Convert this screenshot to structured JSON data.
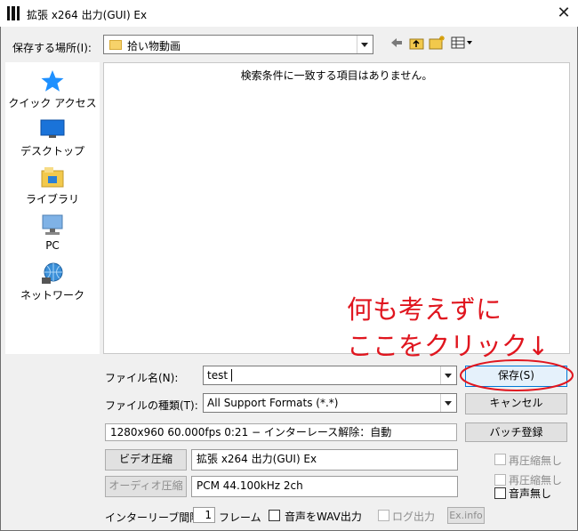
{
  "window": {
    "title": "拡張 x264 出力(GUI) Ex",
    "close_glyph": "✕"
  },
  "location": {
    "label": "保存する場所(I):",
    "current_folder": "拾い物動画"
  },
  "sidebar": {
    "items": [
      {
        "label": "クイック アクセス",
        "icon": "star-icon"
      },
      {
        "label": "デスクトップ",
        "icon": "desktop-icon"
      },
      {
        "label": "ライブラリ",
        "icon": "library-icon"
      },
      {
        "label": "PC",
        "icon": "pc-icon"
      },
      {
        "label": "ネットワーク",
        "icon": "network-icon"
      }
    ]
  },
  "file_list": {
    "empty_message": "検索条件に一致する項目はありません。"
  },
  "annotation": {
    "line1": "何も考えずに",
    "line2": "ここをクリック↓",
    "color": "#e0161f"
  },
  "filename": {
    "label": "ファイル名(N):",
    "value": "test"
  },
  "filetype": {
    "label": "ファイルの種類(T):",
    "value": "All Support Formats (*.*)"
  },
  "buttons": {
    "save": "保存(S)",
    "cancel": "キャンセル",
    "batch": "バッチ登録",
    "video": "ビデオ圧縮",
    "audio": "オーディオ圧縮",
    "exinfo": "Ex.info"
  },
  "info": {
    "summary": "1280x960  60.000fps  0:21  −  インターレース解除：自動",
    "video_codec": "拡張 x264 出力(GUI) Ex",
    "audio_codec": "PCM 44.100kHz 2ch"
  },
  "options": {
    "recompress_none_video": "再圧縮無し",
    "recompress_none_audio": "再圧縮無し",
    "no_audio": "音声無し",
    "interleave_label": "インターリーブ間隔：",
    "interleave_value": "1",
    "interleave_unit": "フレーム",
    "wav_output": "音声をWAV出力",
    "log_output": "ログ出力"
  }
}
